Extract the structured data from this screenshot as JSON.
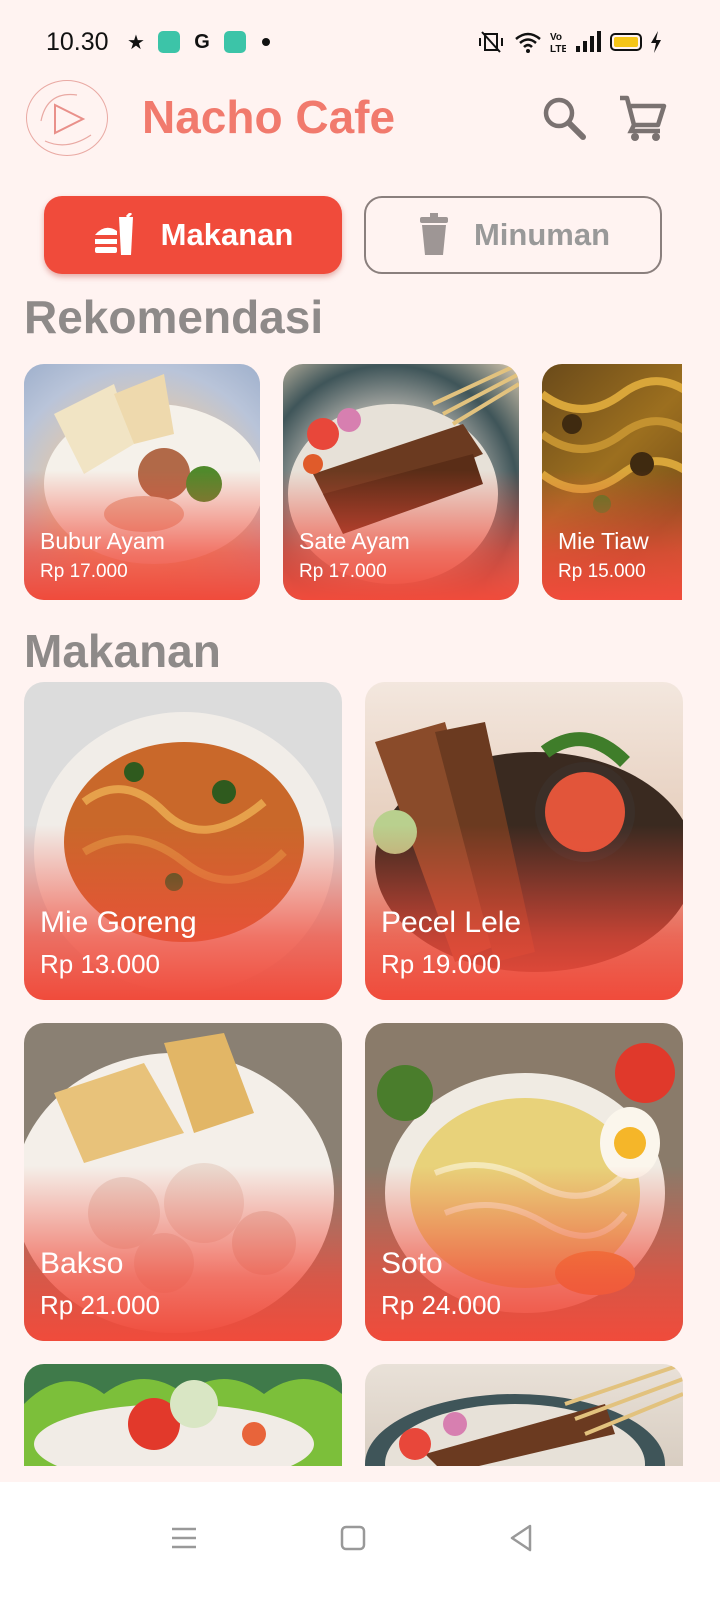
{
  "status_bar": {
    "time": "10.30",
    "google_icon": "G",
    "signal_icon": "signal-icon",
    "wifi_icon": "wifi-icon"
  },
  "app_bar": {
    "title": "Nacho Cafe",
    "logo_icon": "play-logo-icon",
    "search_icon": "search-icon",
    "cart_icon": "cart-icon"
  },
  "categories": [
    {
      "label": "Makanan",
      "icon": "burger-drink-icon",
      "selected": true
    },
    {
      "label": "Minuman",
      "icon": "cup-icon",
      "selected": false
    }
  ],
  "sections": {
    "recommendations": "Rekomendasi",
    "food": "Makanan"
  },
  "recommendations": [
    {
      "name": "Bubur Ayam",
      "price": "Rp 17.000"
    },
    {
      "name": "Sate Ayam",
      "price": "Rp 17.000"
    },
    {
      "name": "Mie Tiaw",
      "price": "Rp 15.000"
    }
  ],
  "food": [
    {
      "name": "Mie Goreng",
      "price": "Rp 13.000"
    },
    {
      "name": "Pecel Lele",
      "price": "Rp 19.000"
    },
    {
      "name": "Bakso",
      "price": "Rp 21.000"
    },
    {
      "name": "Soto",
      "price": "Rp 24.000"
    }
  ],
  "colors": {
    "accent": "#f04b3b",
    "title": "#f17a6d",
    "background": "#fff3f1",
    "section_title": "#8e8a89"
  }
}
